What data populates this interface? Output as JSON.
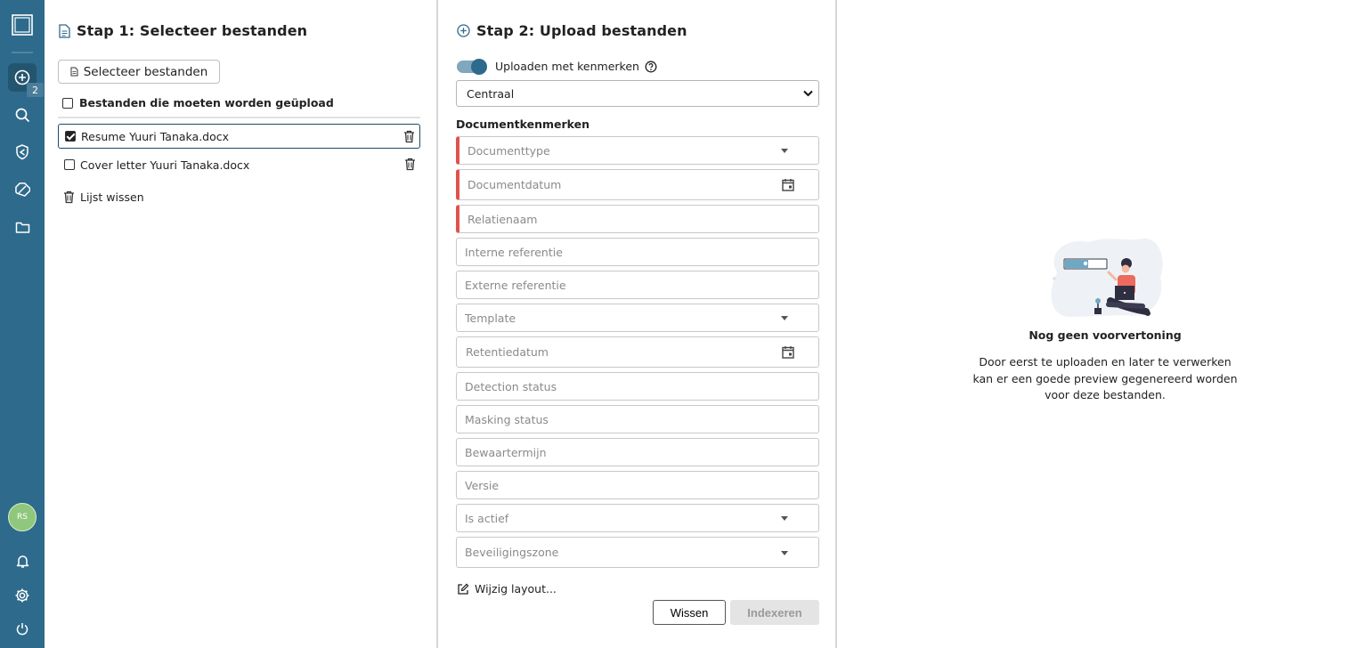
{
  "sidebar": {
    "badge_count": "2",
    "avatar_initials": "RS",
    "accent_color": "#2e6a8c"
  },
  "step1": {
    "title": "Stap 1: Selecteer bestanden",
    "select_button": "Selecteer bestanden",
    "list_header": "Bestanden die moeten worden geüpload",
    "files": [
      {
        "name": "Resume Yuuri Tanaka.docx",
        "checked": true
      },
      {
        "name": "Cover letter Yuuri Tanaka.docx",
        "checked": false
      }
    ],
    "clear_list": "Lijst wissen"
  },
  "step2": {
    "title": "Stap 2: Upload bestanden",
    "toggle_label": "Uploaden met kenmerken",
    "toggle_on": true,
    "location_select": "Centraal",
    "section_label": "Documentkenmerken",
    "fields": {
      "documenttype": "Documenttype",
      "documentdatum": "Documentdatum",
      "relatienaam": "Relatienaam",
      "interne_referentie": "Interne referentie",
      "externe_referentie": "Externe referentie",
      "template": "Template",
      "retentiedatum": "Retentiedatum",
      "detection_status": "Detection status",
      "masking_status": "Masking status",
      "bewaartermijn": "Bewaartermijn",
      "versie": "Versie",
      "is_actief": "Is actief",
      "beveiligingszone": "Beveiligingszone"
    },
    "edit_layout": "Wijzig layout...",
    "clear_button": "Wissen",
    "index_button": "Indexeren",
    "required_color": "#e0524d"
  },
  "preview": {
    "title": "Nog geen voorvertoning",
    "text": "Door eerst te uploaden en later te verwerken kan er een goede preview gegenereerd worden voor deze bestanden."
  }
}
